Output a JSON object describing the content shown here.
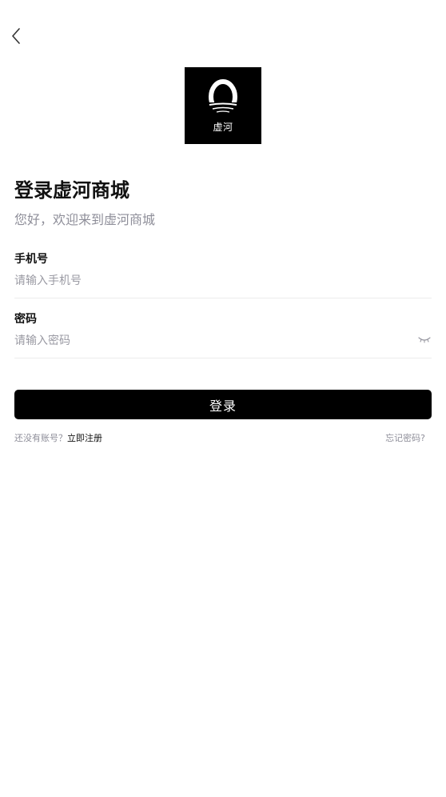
{
  "header": {
    "back_icon": "chevron-left-icon"
  },
  "logo": {
    "caption": "虚河"
  },
  "title": "登录虚河商城",
  "subtitle": "您好，欢迎来到虚河商城",
  "phone": {
    "label": "手机号",
    "placeholder": "请输入手机号",
    "value": ""
  },
  "password": {
    "label": "密码",
    "placeholder": "请输入密码",
    "value": "",
    "toggle_icon": "eye-closed-icon"
  },
  "login_button": "登录",
  "register": {
    "prompt": "还没有账号？",
    "link": "立即注册"
  },
  "forgot_password": "忘记密码?",
  "colors": {
    "primary": "#000000",
    "muted_text": "#8e8e99",
    "divider": "#ececec"
  }
}
